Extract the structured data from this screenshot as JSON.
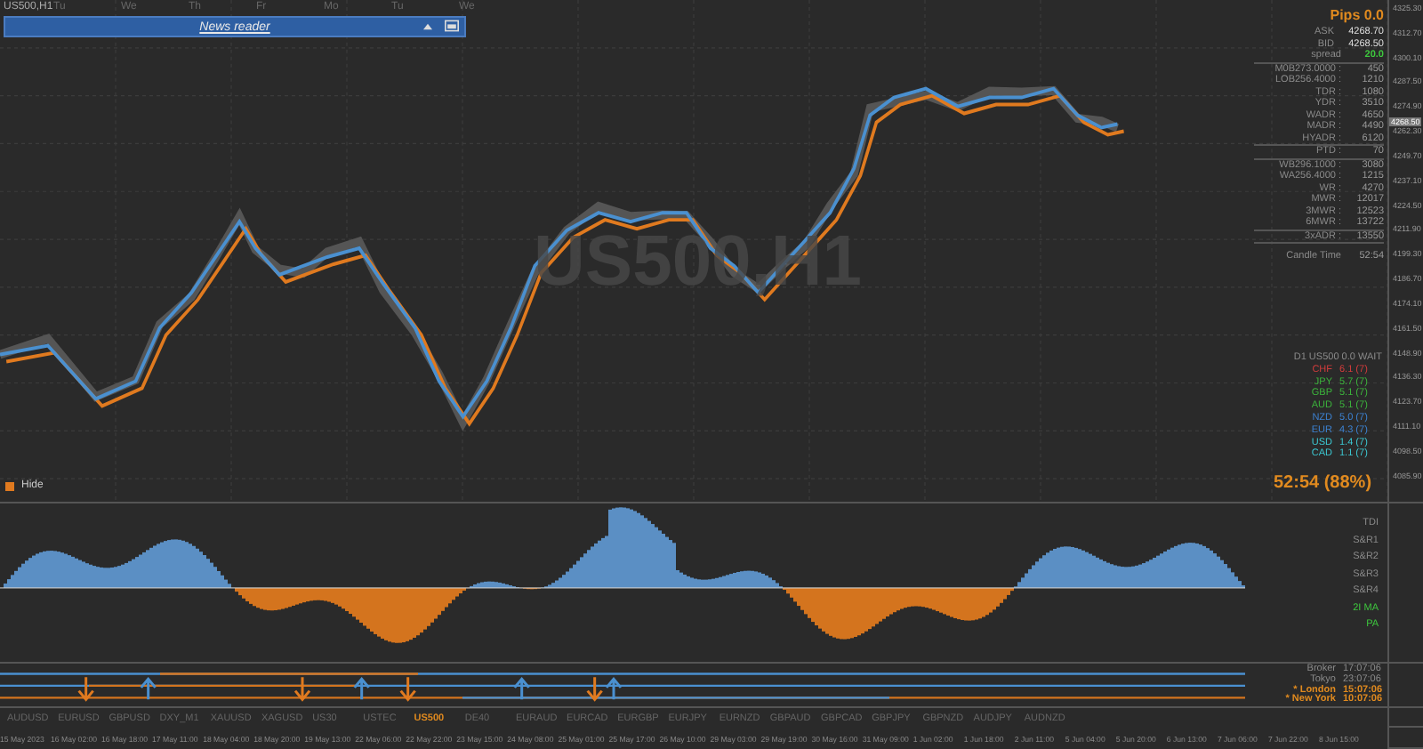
{
  "chart": {
    "symbol": "US500,H1",
    "watermark": "US500,H1",
    "weekdays": [
      "Tu",
      "We",
      "Th",
      "Fr",
      "Mo",
      "Tu",
      "We"
    ]
  },
  "news_reader": {
    "title": "News reader"
  },
  "price_axis": [
    "4325.30",
    "4312.70",
    "4300.10",
    "4287.50",
    "4274.90",
    "4262.30",
    "4249.70",
    "4237.10",
    "4224.50",
    "4211.90",
    "4199.30",
    "4186.70",
    "4174.10",
    "4161.50",
    "4148.90",
    "4136.30",
    "4123.70",
    "4111.10",
    "4098.50",
    "4085.90"
  ],
  "current_price": "4268.50",
  "info_panel": {
    "pips": "Pips 0.0",
    "quotes": [
      {
        "label": "ASK",
        "value": "4268.70"
      },
      {
        "label": "BID",
        "value": "4268.50"
      }
    ],
    "spread": {
      "label": "spread",
      "value": "20.0"
    },
    "groups": [
      [
        {
          "label": "M0B273.0000 :",
          "value": "450"
        },
        {
          "label": "LOB256.4000 :",
          "value": "1210"
        },
        {
          "label": "TDR :",
          "value": "1080"
        },
        {
          "label": "YDR :",
          "value": "3510"
        },
        {
          "label": "WADR :",
          "value": "4650"
        },
        {
          "label": "MADR :",
          "value": "4490"
        },
        {
          "label": "HYADR :",
          "value": "6120"
        }
      ],
      [
        {
          "label": "PTD :",
          "value": "70"
        }
      ],
      [
        {
          "label": "WB296.1000 :",
          "value": "3080"
        },
        {
          "label": "WA256.4000 :",
          "value": "1215"
        },
        {
          "label": "WR :",
          "value": "4270"
        },
        {
          "label": "MWR :",
          "value": "12017"
        },
        {
          "label": "3MWR :",
          "value": "12523"
        },
        {
          "label": "6MWR :",
          "value": "13722"
        }
      ],
      [
        {
          "label": "3xADR :",
          "value": "13550"
        }
      ]
    ],
    "candle_time": {
      "label": "Candle Time",
      "value": "52:54"
    }
  },
  "strength": {
    "title": "D1  US500 0.0 WAIT",
    "rows": [
      {
        "currency": "CHF",
        "value": "6.1 (7)",
        "color": "#d23c3c"
      },
      {
        "currency": "JPY",
        "value": "5.7 (7)",
        "color": "#3cb43c"
      },
      {
        "currency": "GBP",
        "value": "5.1 (7)",
        "color": "#3cb43c"
      },
      {
        "currency": "AUD",
        "value": "5.1 (7)",
        "color": "#3cb43c"
      },
      {
        "currency": "NZD",
        "value": "5.0 (7)",
        "color": "#3c82d2"
      },
      {
        "currency": "EUR",
        "value": "4.3 (7)",
        "color": "#3c82d2"
      },
      {
        "currency": "USD",
        "value": "1.4 (7)",
        "color": "#3cc8d2"
      },
      {
        "currency": "CAD",
        "value": "1.1 (7)",
        "color": "#3cc8d2"
      }
    ]
  },
  "hide_button": {
    "label": "Hide"
  },
  "countdown": "52:54 (88%)",
  "oscillator": {
    "labels": [
      {
        "text": "TDI",
        "kind": "plain"
      },
      {
        "text": "S&R1",
        "kind": "plain"
      },
      {
        "text": "S&R2",
        "kind": "plain"
      },
      {
        "text": "S&R3",
        "kind": "plain"
      },
      {
        "text": "S&R4",
        "kind": "plain"
      },
      {
        "text": "2I MA",
        "kind": "active"
      },
      {
        "text": "PA",
        "kind": "active"
      }
    ]
  },
  "sessions": [
    {
      "name": "Broker",
      "time": "17:07:06",
      "highlighted": false
    },
    {
      "name": "Tokyo",
      "time": "23:07:06",
      "highlighted": false
    },
    {
      "name": "* London",
      "time": "15:07:06",
      "highlighted": true
    },
    {
      "name": "* New York",
      "time": "10:07:06",
      "highlighted": true
    }
  ],
  "symbols": [
    {
      "label": "AUDUSD",
      "selected": false
    },
    {
      "label": "EURUSD",
      "selected": false
    },
    {
      "label": "GBPUSD",
      "selected": false
    },
    {
      "label": "DXY_M1",
      "selected": false
    },
    {
      "label": "XAUUSD",
      "selected": false
    },
    {
      "label": "XAGUSD",
      "selected": false
    },
    {
      "label": "US30",
      "selected": false
    },
    {
      "label": "USTEC",
      "selected": false
    },
    {
      "label": "US500",
      "selected": true
    },
    {
      "label": "DE40",
      "selected": false
    },
    {
      "label": "EURAUD",
      "selected": false
    },
    {
      "label": "EURCAD",
      "selected": false
    },
    {
      "label": "EURGBP",
      "selected": false
    },
    {
      "label": "EURJPY",
      "selected": false
    },
    {
      "label": "EURNZD",
      "selected": false
    },
    {
      "label": "GBPAUD",
      "selected": false
    },
    {
      "label": "GBPCAD",
      "selected": false
    },
    {
      "label": "GBPJPY",
      "selected": false
    },
    {
      "label": "GBPNZD",
      "selected": false
    },
    {
      "label": "AUDJPY",
      "selected": false
    },
    {
      "label": "AUDNZD",
      "selected": false
    }
  ],
  "time_axis": [
    "15 May 2023",
    "16 May 02:00",
    "16 May 18:00",
    "17 May 11:00",
    "18 May 04:00",
    "18 May 20:00",
    "19 May 13:00",
    "22 May 06:00",
    "22 May 22:00",
    "23 May 15:00",
    "24 May 08:00",
    "25 May 01:00",
    "25 May 17:00",
    "26 May 10:00",
    "29 May 03:00",
    "29 May 19:00",
    "30 May 16:00",
    "31 May 09:00",
    "1 Jun 02:00",
    "1 Jun 18:00",
    "2 Jun 11:00",
    "5 Jun 04:00",
    "5 Jun 20:00",
    "6 Jun 13:00",
    "7 Jun 06:00",
    "7 Jun 22:00",
    "8 Jun 15:00"
  ]
}
